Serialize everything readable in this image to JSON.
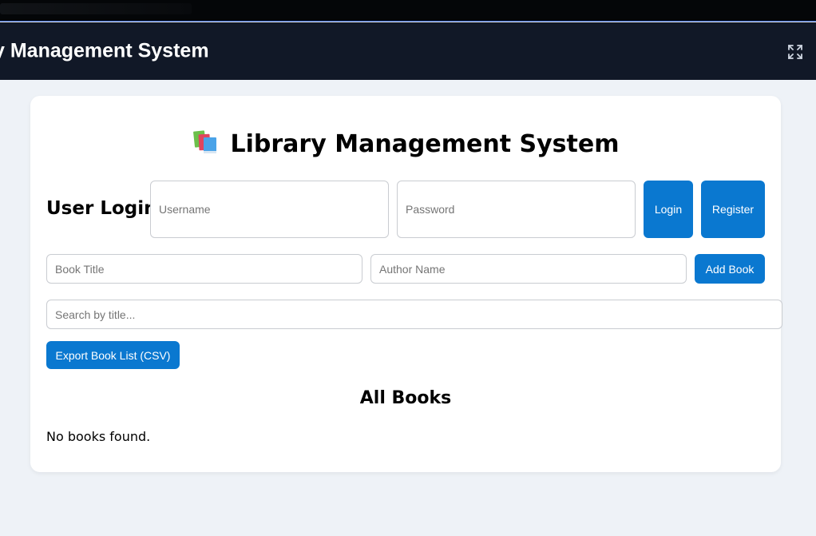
{
  "app_bar": {
    "title": "y Management System",
    "fullscreen_icon": "expand-icon"
  },
  "main": {
    "heading": "Library Management System",
    "heading_icon": "books-icon",
    "login": {
      "label": "User Login",
      "username_placeholder": "Username",
      "password_placeholder": "Password",
      "login_button": "Login",
      "register_button": "Register"
    },
    "add_book": {
      "title_placeholder": "Book Title",
      "author_placeholder": "Author Name",
      "add_button": "Add Book"
    },
    "search": {
      "placeholder": "Search by title..."
    },
    "export_button": "Export Book List (CSV)",
    "list_heading": "All Books",
    "empty_message": "No books found."
  },
  "colors": {
    "accent": "#0a78d0",
    "app_bar_bg": "#111827",
    "page_bg": "#eef2f7"
  }
}
